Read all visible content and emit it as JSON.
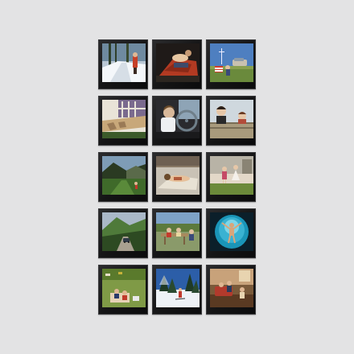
{
  "gallery": {
    "background_color": "#e3e3e4",
    "frame_color": "#141415",
    "rows": 5,
    "columns": 3,
    "slides": [
      {
        "subject": "snowy-path-with-child",
        "palette": [
          "#b9c7d4",
          "#ffffff",
          "#2f3f2a",
          "#c64028"
        ]
      },
      {
        "subject": "person-lying-on-red-blanket",
        "palette": [
          "#1f1a18",
          "#b23a22",
          "#e7c7a2",
          "#3d4a6a"
        ]
      },
      {
        "subject": "family-picnic-with-car",
        "palette": [
          "#4e7fc0",
          "#6a8a3c",
          "#c8c1b0",
          "#d23c2c"
        ]
      },
      {
        "subject": "sunlit-porch-with-shadows",
        "palette": [
          "#e9e4d8",
          "#7a6a8e",
          "#3c5a2a",
          "#c8a87a"
        ]
      },
      {
        "subject": "child-driving-car",
        "palette": [
          "#2a2a2e",
          "#8ea4b6",
          "#d8b89a",
          "#6f7f8a"
        ]
      },
      {
        "subject": "two-girls-on-balcony",
        "palette": [
          "#cfd8de",
          "#e6c7a8",
          "#b24c3a",
          "#a89a7c"
        ]
      },
      {
        "subject": "hiker-in-green-valley",
        "palette": [
          "#7e9cb6",
          "#3f6a2a",
          "#2a3a22",
          "#c0392b"
        ]
      },
      {
        "subject": "woman-sunbathing",
        "palette": [
          "#c9c2b5",
          "#e8e2d4",
          "#8a7a66",
          "#b05a3a"
        ]
      },
      {
        "subject": "children-on-lawn",
        "palette": [
          "#b8b3a6",
          "#6c8a3a",
          "#e3d8c8",
          "#c54a66"
        ]
      },
      {
        "subject": "mountain-road-with-car",
        "palette": [
          "#aab8c8",
          "#4f7a3a",
          "#2d4a22",
          "#303a48"
        ]
      },
      {
        "subject": "roadside-picnic-table",
        "palette": [
          "#7ea2c6",
          "#5c7a3c",
          "#a88a5e",
          "#c43a2c"
        ]
      },
      {
        "subject": "diver-in-round-pool",
        "palette": [
          "#0b1f2a",
          "#1a95b8",
          "#7fd6e8",
          "#d9a57a"
        ]
      },
      {
        "subject": "family-on-grass",
        "palette": [
          "#7f9a46",
          "#5a7a2c",
          "#e6d2b6",
          "#c8b23a"
        ]
      },
      {
        "subject": "snowy-forest-skier",
        "palette": [
          "#2c5ea8",
          "#eef2f6",
          "#1f3a26",
          "#c0392b"
        ]
      },
      {
        "subject": "family-in-living-room",
        "palette": [
          "#7a5a3a",
          "#c8a27a",
          "#b23a2c",
          "#e8d4b0"
        ]
      }
    ]
  }
}
